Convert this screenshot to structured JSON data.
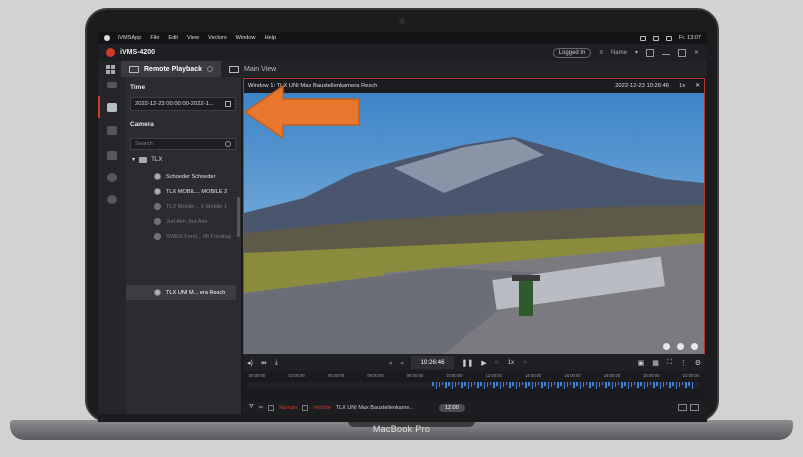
{
  "device": {
    "brand_label": "MacBook Pro"
  },
  "menubar": {
    "items": [
      "iVMSApp",
      "File",
      "Edit",
      "View",
      "Vectors",
      "Window",
      "Help"
    ],
    "clock": "Fr. 13:07"
  },
  "app": {
    "title": "iVMS-4200",
    "logged_in_label": "Logged In",
    "user_label": "Name"
  },
  "tabs": [
    {
      "label": "Remote Playback",
      "active": true
    },
    {
      "label": "Main View",
      "active": false
    }
  ],
  "left_panel": {
    "time_label": "Time",
    "date_range": "2022-12-23 00:00:00-2022-1...",
    "camera_label": "Camera",
    "search_placeholder": "Search",
    "group_name": "TLX",
    "cameras": [
      {
        "label": "Schoeder Schoeder",
        "state": "bright"
      },
      {
        "label": "TLX MOBIL... MOBILE 2",
        "state": "bright"
      },
      {
        "label": "TLX Mobile... X Mobile 1",
        "state": "dim"
      },
      {
        "label": "Jod Alm Jod Alm",
        "state": "dim"
      },
      {
        "label": "SWEN Forst... lift Forsttag",
        "state": "dim"
      },
      {
        "label": "TLX UNI M... era Resch",
        "state": "selected"
      }
    ]
  },
  "viewer": {
    "window_title": "Window 1: TLX UNI Max Baustellenkamera Resch",
    "timestamp": "2022-12-23 10:26:46",
    "speed_label": "1x",
    "close_label": "✕"
  },
  "playback": {
    "current_time": "10:26:46",
    "speed": "1x"
  },
  "timeline": {
    "labels": [
      "00:00:00",
      "02:00:00",
      "04:00:00",
      "06:00:00",
      "08:00:00",
      "10:00:00",
      "12:00:00",
      "14:00:00",
      "16:00:00",
      "18:00:00",
      "20:00:00",
      "22:00:00"
    ],
    "recording_fraction_start": 0.41,
    "recording_fraction_end": 0.99
  },
  "bottombar": {
    "human_label": "Human",
    "vehicle_label": "Vehicle",
    "camera_name": "TLX UNI Max Baustellenkame...",
    "cursor_time": "12:00"
  },
  "colors": {
    "accent": "#d23a2c",
    "arrow": "#e8772e",
    "timeline_bar": "#3f7fd8"
  }
}
